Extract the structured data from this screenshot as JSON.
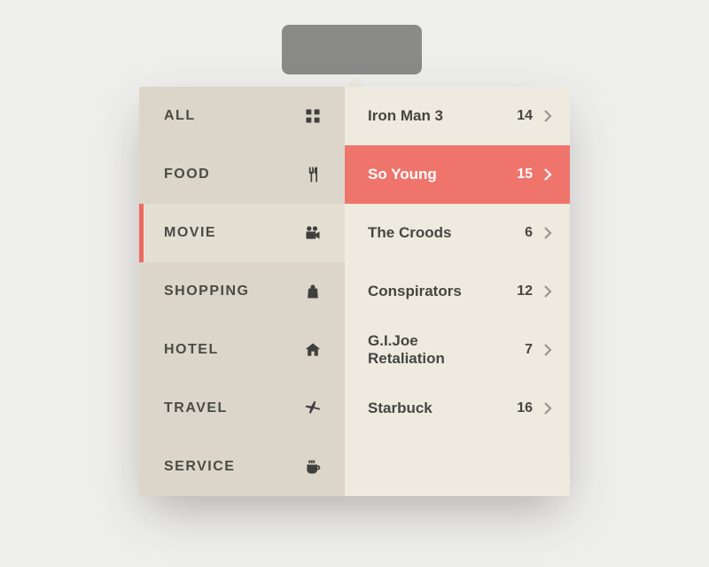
{
  "colors": {
    "accent": "#ef746c",
    "panel_left": "#dbd6c9",
    "panel_right": "#eeeae0",
    "text": "#464641"
  },
  "categories": [
    {
      "label": "ALL",
      "icon": "grid-icon",
      "active": false
    },
    {
      "label": "FOOD",
      "icon": "utensils-icon",
      "active": false
    },
    {
      "label": "MOVIE",
      "icon": "camera-icon",
      "active": true
    },
    {
      "label": "SHOPPING",
      "icon": "bag-icon",
      "active": false
    },
    {
      "label": "HOTEL",
      "icon": "house-icon",
      "active": false
    },
    {
      "label": "TRAVEL",
      "icon": "plane-icon",
      "active": false
    },
    {
      "label": "SERVICE",
      "icon": "cup-icon",
      "active": false
    }
  ],
  "items": [
    {
      "title": "Iron Man 3",
      "count": 14,
      "selected": false
    },
    {
      "title": "So Young",
      "count": 15,
      "selected": true
    },
    {
      "title": "The Croods",
      "count": 6,
      "selected": false
    },
    {
      "title": "Conspirators",
      "count": 12,
      "selected": false
    },
    {
      "title": "G.I.Joe Retaliation",
      "count": 7,
      "selected": false
    },
    {
      "title": "Starbuck",
      "count": 16,
      "selected": false
    }
  ]
}
